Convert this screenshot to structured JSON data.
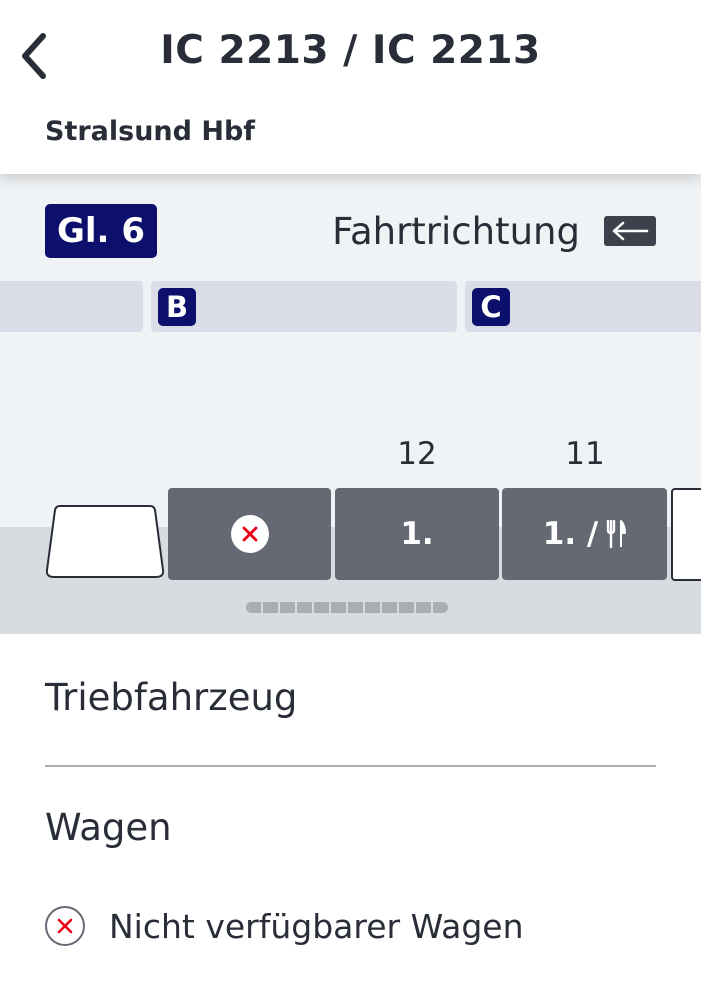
{
  "header": {
    "title": "IC 2213 / IC 2213",
    "station": "Stralsund Hbf",
    "back_icon": "chevron-left-icon"
  },
  "platform": {
    "track_label": "Gl. 6",
    "direction_label": "Fahrtrichtung",
    "direction_icon": "arrow-left-icon",
    "sectors": [
      "B",
      "C"
    ]
  },
  "train": {
    "wagon_numbers": [
      "12",
      "11"
    ],
    "wagons": [
      {
        "type": "locomotive"
      },
      {
        "type": "unavailable",
        "icon": "x-circle-icon"
      },
      {
        "type": "coach",
        "class_label": "1."
      },
      {
        "type": "coach",
        "class_label": "1. /",
        "icon": "cutlery-icon"
      },
      {
        "type": "partial"
      }
    ],
    "overview_segments": 12
  },
  "legend": {
    "section_1": "Triebfahrzeug",
    "section_2": "Wagen",
    "items": [
      {
        "icon": "x-circle-icon",
        "label": "Nicht verfügbarer Wagen"
      }
    ]
  },
  "colors": {
    "brand_navy": "#0c0f6b",
    "wagon_gray": "#646973",
    "unavailable_red": "#ec0016",
    "text_dark": "#282d37"
  }
}
